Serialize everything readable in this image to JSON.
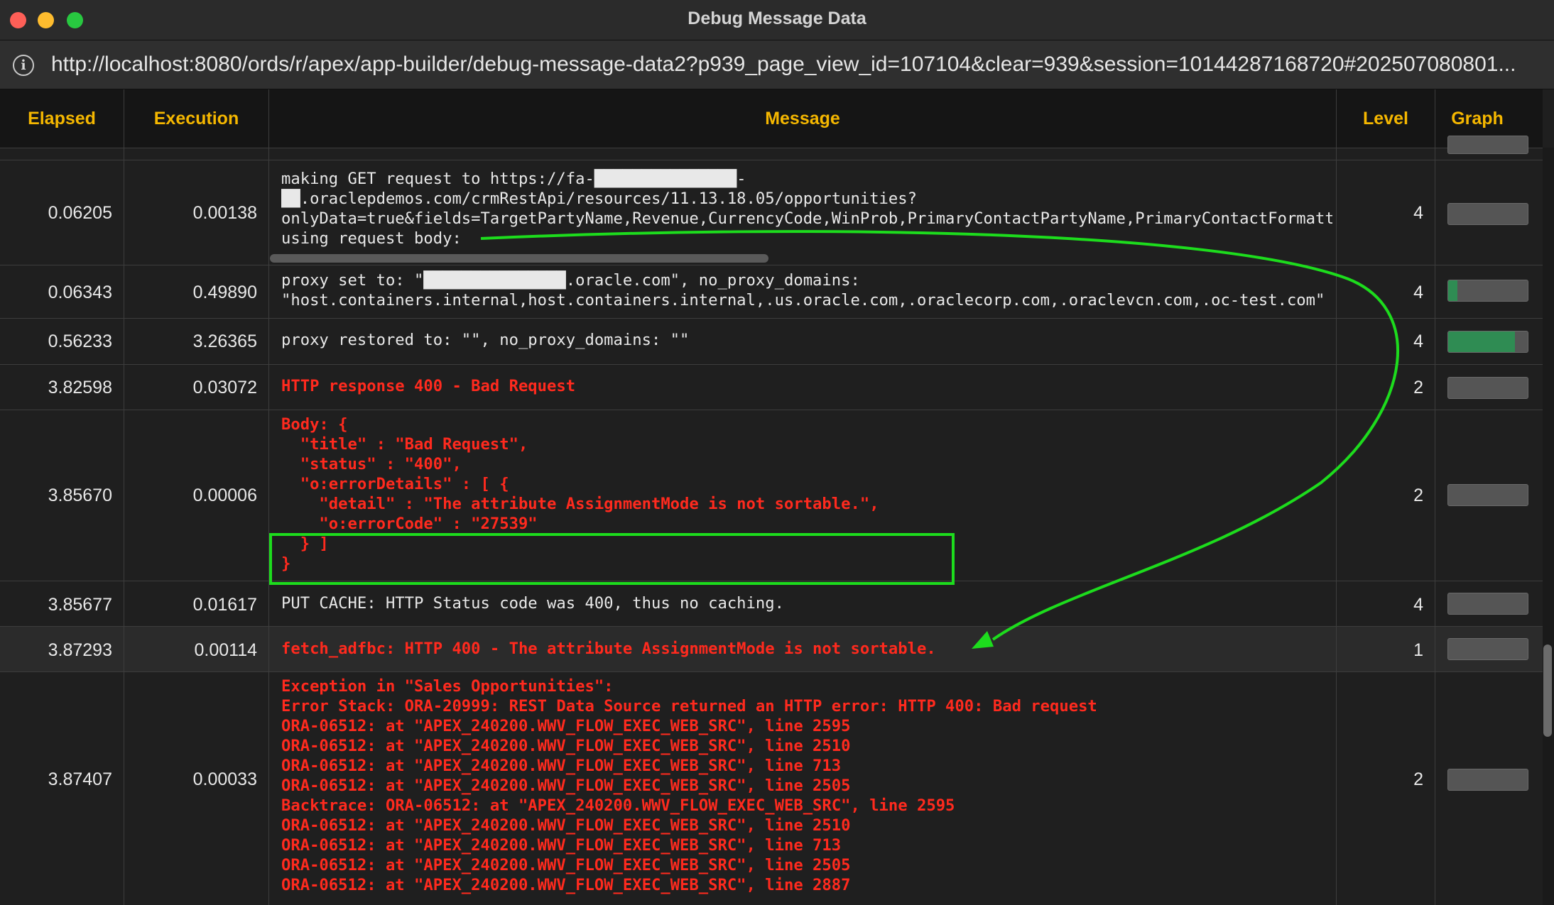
{
  "window": {
    "title": "Debug Message Data",
    "url": "http://localhost:8080/ords/r/apex/app-builder/debug-message-data2?p939_page_view_id=107104&clear=939&session=10144287168720#202507080801..."
  },
  "columns": {
    "elapsed": "Elapsed",
    "execution": "Execution",
    "message": "Message",
    "level": "Level",
    "graph": "Graph"
  },
  "rows": [
    {
      "elapsed": "0.06205",
      "execution": "0.00138",
      "message": "making GET request to https://fa-███████████████-\n██.oraclepdemos.com/crmRestApi/resources/11.13.18.05/opportunities?\nonlyData=true&fields=TargetPartyName,Revenue,CurrencyCode,WinProb,PrimaryContactPartyName,PrimaryContactFormatte\nusing request body:",
      "level": "4",
      "graph_fraction": 0.0
    },
    {
      "elapsed": "0.06343",
      "execution": "0.49890",
      "message": "proxy set to: \"███████████████.oracle.com\", no_proxy_domains:\n\"host.containers.internal,host.containers.internal,.us.oracle.com,.oraclecorp.com,.oraclevcn.com,.oc-test.com\"",
      "level": "4",
      "graph_fraction": 0.12
    },
    {
      "elapsed": "0.56233",
      "execution": "3.26365",
      "message": "proxy restored to: \"\", no_proxy_domains: \"\"",
      "level": "4",
      "graph_fraction": 0.84
    },
    {
      "elapsed": "3.82598",
      "execution": "0.03072",
      "message": "HTTP response 400 - Bad Request",
      "level": "2",
      "graph_fraction": 0.0
    },
    {
      "elapsed": "3.85670",
      "execution": "0.00006",
      "message": "Body: {\n  \"title\" : \"Bad Request\",\n  \"status\" : \"400\",\n  \"o:errorDetails\" : [ {\n    \"detail\" : \"The attribute AssignmentMode is not sortable.\",\n    \"o:errorCode\" : \"27539\"\n  } ]\n}",
      "level": "2",
      "graph_fraction": 0.0
    },
    {
      "elapsed": "3.85677",
      "execution": "0.01617",
      "message": "PUT CACHE: HTTP Status code was 400, thus no caching.",
      "level": "4",
      "graph_fraction": 0.0
    },
    {
      "elapsed": "3.87293",
      "execution": "0.00114",
      "message": "fetch_adfbc: HTTP 400 - The attribute AssignmentMode is not sortable.",
      "level": "1",
      "graph_fraction": 0.0
    },
    {
      "elapsed": "3.87407",
      "execution": "0.00033",
      "message": "Exception in \"Sales Opportunities\":\nError Stack: ORA-20999: REST Data Source returned an HTTP error: HTTP 400: Bad request\nORA-06512: at \"APEX_240200.WWV_FLOW_EXEC_WEB_SRC\", line 2595\nORA-06512: at \"APEX_240200.WWV_FLOW_EXEC_WEB_SRC\", line 2510\nORA-06512: at \"APEX_240200.WWV_FLOW_EXEC_WEB_SRC\", line 713\nORA-06512: at \"APEX_240200.WWV_FLOW_EXEC_WEB_SRC\", line 2505\nBacktrace: ORA-06512: at \"APEX_240200.WWV_FLOW_EXEC_WEB_SRC\", line 2595\nORA-06512: at \"APEX_240200.WWV_FLOW_EXEC_WEB_SRC\", line 2510\nORA-06512: at \"APEX_240200.WWV_FLOW_EXEC_WEB_SRC\", line 713\nORA-06512: at \"APEX_240200.WWV_FLOW_EXEC_WEB_SRC\", line 2505\nORA-06512: at \"APEX_240200.WWV_FLOW_EXEC_WEB_SRC\", line 2887",
      "level": "2",
      "graph_fraction": 0.0
    }
  ],
  "colors": {
    "header_text": "#f5b700",
    "error_text": "#ff2a1e",
    "graph_fill": "#2f8c53",
    "annotation": "#1ddc1d"
  }
}
